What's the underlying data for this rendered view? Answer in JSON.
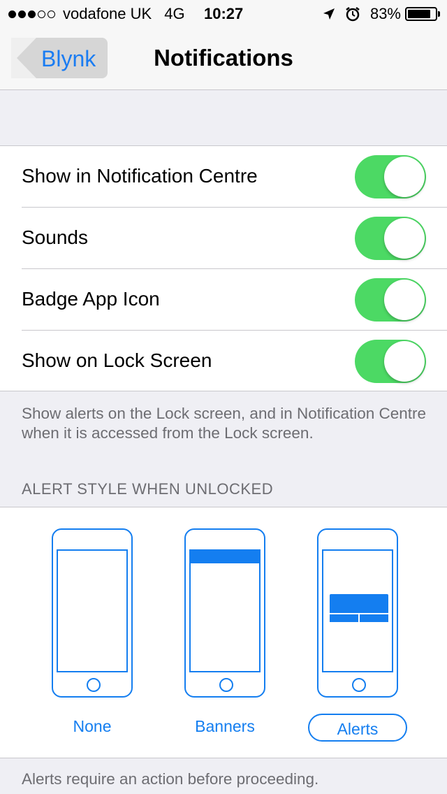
{
  "status_bar": {
    "carrier": "vodafone UK",
    "network": "4G",
    "time": "10:27",
    "battery_percent": "83%",
    "battery_level": 0.83,
    "signal_bars_filled": 3,
    "signal_bars_total": 5,
    "icons": [
      "location-arrow-icon",
      "alarm-clock-icon",
      "battery-icon"
    ]
  },
  "nav": {
    "back_label": "Blynk",
    "title": "Notifications"
  },
  "toggles": [
    {
      "label": "Show in Notification Centre",
      "on": true
    },
    {
      "label": "Sounds",
      "on": true
    },
    {
      "label": "Badge App Icon",
      "on": true
    },
    {
      "label": "Show on Lock Screen",
      "on": true
    }
  ],
  "lock_screen_footer": "Show alerts on the Lock screen, and in Notification Centre when it is accessed from the Lock screen.",
  "alert_style": {
    "header": "ALERT STYLE WHEN UNLOCKED",
    "options": [
      {
        "label": "None",
        "selected": false
      },
      {
        "label": "Banners",
        "selected": false
      },
      {
        "label": "Alerts",
        "selected": true
      }
    ],
    "footer": "Alerts require an action before proceeding."
  },
  "colors": {
    "accent": "#147ef0",
    "toggle_on": "#4cd964",
    "background": "#efeff4",
    "secondary_text": "#6d6d72"
  }
}
